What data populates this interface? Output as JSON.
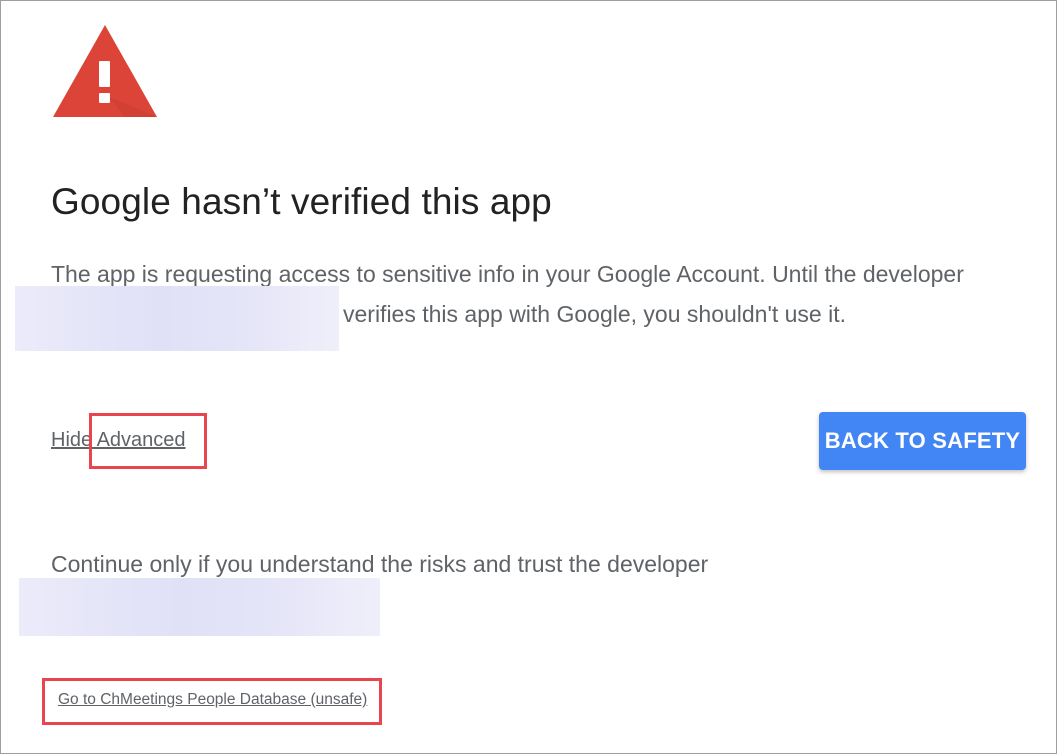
{
  "colors": {
    "warning_red": "#db4437",
    "button_blue": "#4285f4",
    "highlight_red": "#e8454f",
    "body_text": "#5f6368",
    "title_text": "#222222"
  },
  "icon": {
    "name": "warning-triangle-icon",
    "glyph": "!"
  },
  "title": "Google hasn’t verified this app",
  "description": {
    "line1": "The app is requesting access to sensitive info in your Google Account. Until the developer",
    "line2": "verifies this app with Google, you shouldn't use it."
  },
  "advanced_toggle_label": "Hide Advanced",
  "back_button_label": "BACK TO SAFETY",
  "continue_text": "Continue only if you understand the risks and trust the developer",
  "goto_link_label": "Go to ChMeetings People Database (unsafe)"
}
